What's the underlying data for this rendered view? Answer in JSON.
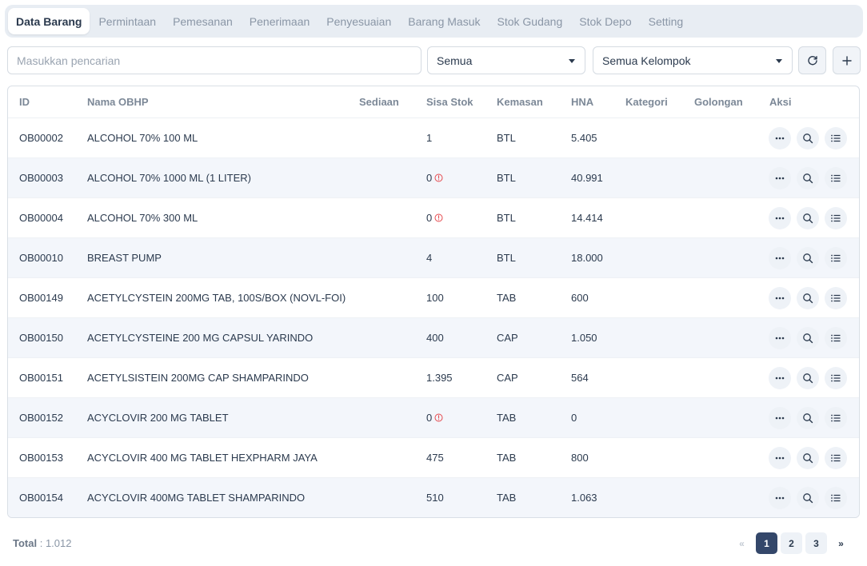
{
  "tabs": [
    {
      "label": "Data Barang",
      "active": true
    },
    {
      "label": "Permintaan"
    },
    {
      "label": "Pemesanan"
    },
    {
      "label": "Penerimaan"
    },
    {
      "label": "Penyesuaian"
    },
    {
      "label": "Barang Masuk"
    },
    {
      "label": "Stok Gudang"
    },
    {
      "label": "Stok Depo"
    },
    {
      "label": "Setting"
    }
  ],
  "filters": {
    "search_placeholder": "Masukkan pencarian",
    "search_value": "",
    "select_status": "Semua",
    "select_group": "Semua Kelompok"
  },
  "table": {
    "headers": [
      "ID",
      "Nama OBHP",
      "Sediaan",
      "Sisa Stok",
      "Kemasan",
      "HNA",
      "Kategori",
      "Golongan",
      "Aksi"
    ],
    "rows": [
      {
        "id": "OB00002",
        "nama": "ALCOHOL 70% 100 ML",
        "sediaan": "",
        "sisa": "1",
        "warn": false,
        "kemasan": "BTL",
        "hna": "5.405",
        "kategori": "",
        "golongan": ""
      },
      {
        "id": "OB00003",
        "nama": "ALCOHOL 70% 1000 ML (1 LITER)",
        "sediaan": "",
        "sisa": "0",
        "warn": true,
        "kemasan": "BTL",
        "hna": "40.991",
        "kategori": "",
        "golongan": ""
      },
      {
        "id": "OB00004",
        "nama": "ALCOHOL 70% 300 ML",
        "sediaan": "",
        "sisa": "0",
        "warn": true,
        "kemasan": "BTL",
        "hna": "14.414",
        "kategori": "",
        "golongan": ""
      },
      {
        "id": "OB00010",
        "nama": "BREAST PUMP",
        "sediaan": "",
        "sisa": "4",
        "warn": false,
        "kemasan": "BTL",
        "hna": "18.000",
        "kategori": "",
        "golongan": ""
      },
      {
        "id": "OB00149",
        "nama": "ACETYLCYSTEIN 200MG TAB, 100S/BOX (NOVL-FOI)",
        "sediaan": "",
        "sisa": "100",
        "warn": false,
        "kemasan": "TAB",
        "hna": "600",
        "kategori": "",
        "golongan": ""
      },
      {
        "id": "OB00150",
        "nama": "ACETYLCYSTEINE 200 MG CAPSUL YARINDO",
        "sediaan": "",
        "sisa": "400",
        "warn": false,
        "kemasan": "CAP",
        "hna": "1.050",
        "kategori": "",
        "golongan": ""
      },
      {
        "id": "OB00151",
        "nama": "ACETYLSISTEIN 200MG CAP SHAMPARINDO",
        "sediaan": "",
        "sisa": "1.395",
        "warn": false,
        "kemasan": "CAP",
        "hna": "564",
        "kategori": "",
        "golongan": ""
      },
      {
        "id": "OB00152",
        "nama": "ACYCLOVIR 200 MG TABLET",
        "sediaan": "",
        "sisa": "0",
        "warn": true,
        "kemasan": "TAB",
        "hna": "0",
        "kategori": "",
        "golongan": ""
      },
      {
        "id": "OB00153",
        "nama": "ACYCLOVIR 400 MG TABLET HEXPHARM JAYA",
        "sediaan": "",
        "sisa": "475",
        "warn": false,
        "kemasan": "TAB",
        "hna": "800",
        "kategori": "",
        "golongan": ""
      },
      {
        "id": "OB00154",
        "nama": "ACYCLOVIR 400MG TABLET SHAMPARINDO",
        "sediaan": "",
        "sisa": "510",
        "warn": false,
        "kemasan": "TAB",
        "hna": "1.063",
        "kategori": "",
        "golongan": ""
      }
    ]
  },
  "footer": {
    "total_label": "Total",
    "total_value": ": 1.012",
    "pages": [
      "1",
      "2",
      "3"
    ],
    "current_page": "1",
    "prev": "«",
    "next": "»"
  },
  "colors": {
    "accent": "#34476a",
    "warning": "#e5484d",
    "row_alt": "#f3f6fb"
  },
  "icons": [
    "refresh-icon",
    "plus-icon",
    "chevron-down-icon",
    "warning-icon",
    "more-icon",
    "search-icon",
    "list-icon"
  ]
}
